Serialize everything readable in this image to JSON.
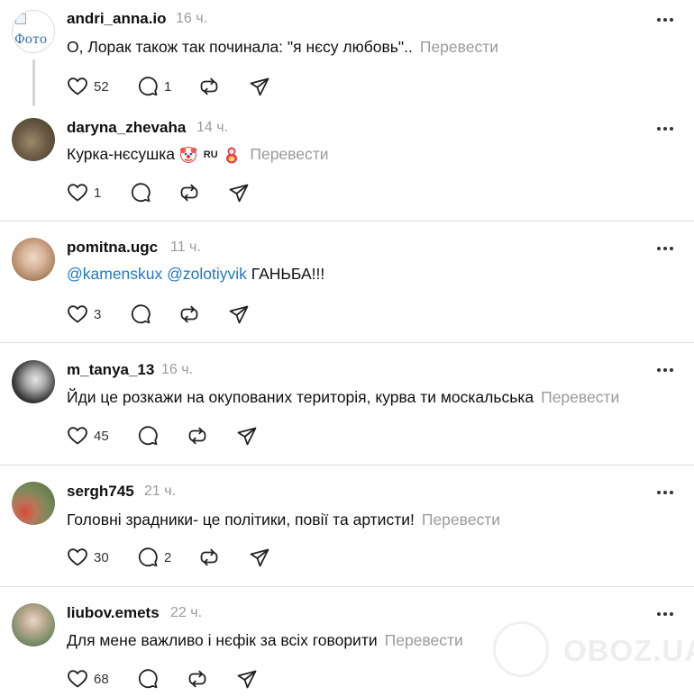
{
  "ui": {
    "translate_label": "Перевести",
    "watermark_text": "OBOZ.UA"
  },
  "posts": [
    {
      "username": "andri_anna.io",
      "time": "16 ч.",
      "avatar_alt": "Фото",
      "text": "О, Лорак також так починала: \"я нєсу любовь\"..",
      "likes": "52",
      "replies": "1"
    },
    {
      "username": "daryna_zhevaha",
      "time": "14 ч.",
      "text": "Курка-нєсушка",
      "emoji_label": "RU",
      "likes": "1",
      "replies": ""
    },
    {
      "username": "pomitna.ugc",
      "time": "11 ч.",
      "mention_1": "@kamenskux",
      "mention_2": "@zolotiyvik",
      "text": "ГАНЬБА!!!",
      "likes": "3",
      "replies": ""
    },
    {
      "username": "m_tanya_13",
      "time": "16 ч.",
      "text": "Йди це розкажи на окупованих територія, курва ти москальська",
      "likes": "45",
      "replies": ""
    },
    {
      "username": "sergh745",
      "time": "21 ч.",
      "text": "Головні зрадники- це політики, повії та артисти!",
      "likes": "30",
      "replies": "2"
    },
    {
      "username": "liubov.emets",
      "time": "22 ч.",
      "text": "Для мене важливо і нєфік за всіх говорити",
      "likes": "68",
      "replies": ""
    }
  ]
}
